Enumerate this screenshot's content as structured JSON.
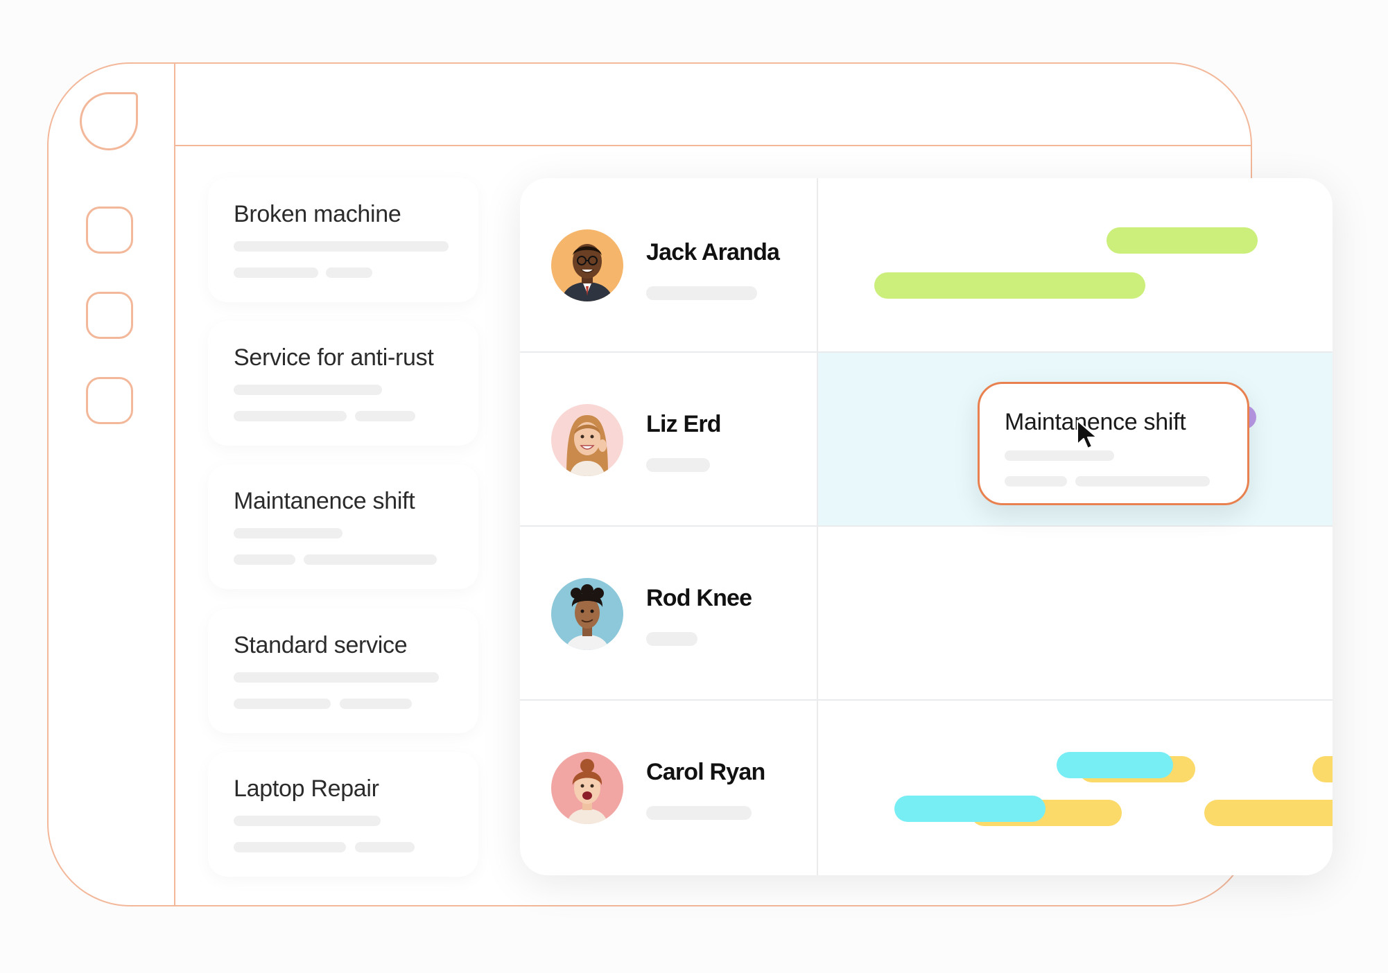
{
  "tasks": [
    {
      "title": "Broken machine"
    },
    {
      "title": "Service for anti-rust"
    },
    {
      "title": "Maintanence shift"
    },
    {
      "title": "Standard service"
    },
    {
      "title": "Laptop Repair"
    }
  ],
  "people": [
    {
      "name": "Jack Aranda",
      "bar_color": "#cbef7a"
    },
    {
      "name": "Liz Erd",
      "bar_color": "#e9f9fb"
    },
    {
      "name": "Rod Knee",
      "bar_color": "#fcda6a"
    },
    {
      "name": "Carol Ryan",
      "bar_color": "#77eef4"
    }
  ],
  "popup": {
    "title": "Maintanence shift"
  },
  "colors": {
    "accent": "#f3b79a",
    "popup_border": "#e8814f"
  }
}
